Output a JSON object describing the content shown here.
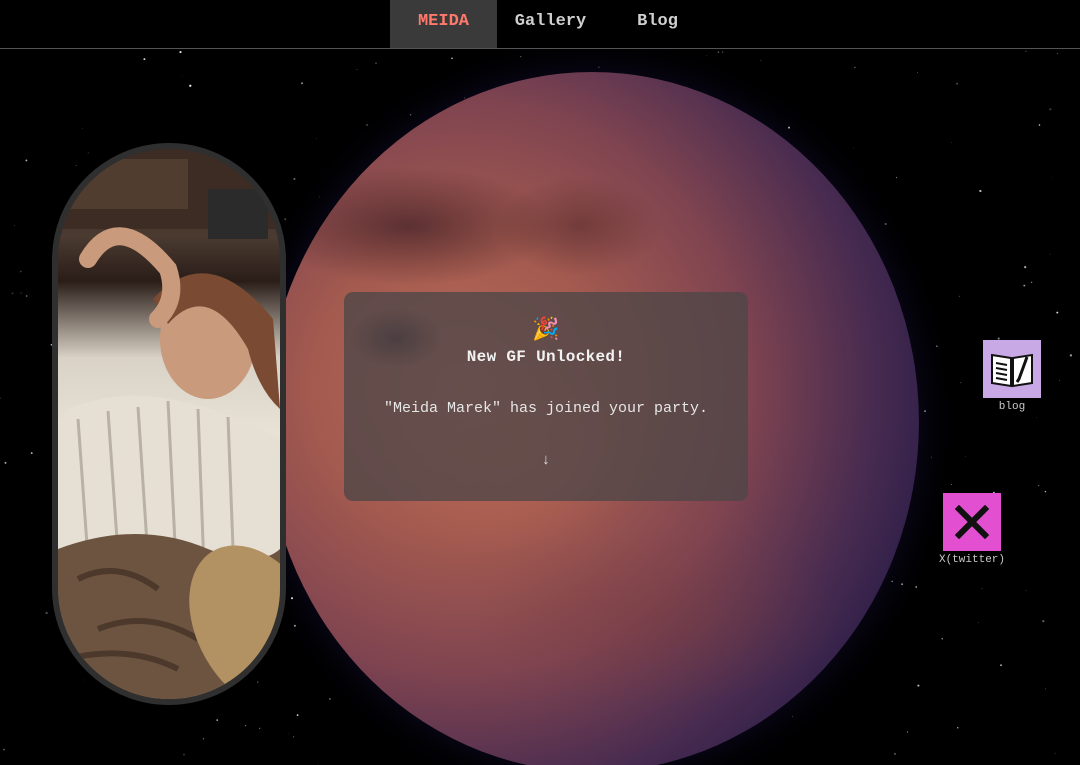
{
  "nav": {
    "items": [
      {
        "label": "MEIDA",
        "active": true
      },
      {
        "label": "Gallery",
        "active": false
      },
      {
        "label": "Blog",
        "active": false
      }
    ]
  },
  "dialog": {
    "emoji": "🎉",
    "title": "New GF Unlocked!",
    "message": "\"Meida Marek\" has joined your party.",
    "arrow": "↓"
  },
  "desktop_icons": [
    {
      "label": "blog",
      "icon": "open-book-pen-icon"
    },
    {
      "label": "X(twitter)",
      "icon": "x-logo-icon"
    }
  ],
  "colors": {
    "accent": "#ff7a6a",
    "blog_tile": "#c9a8e6",
    "x_tile": "#e24fd0"
  }
}
